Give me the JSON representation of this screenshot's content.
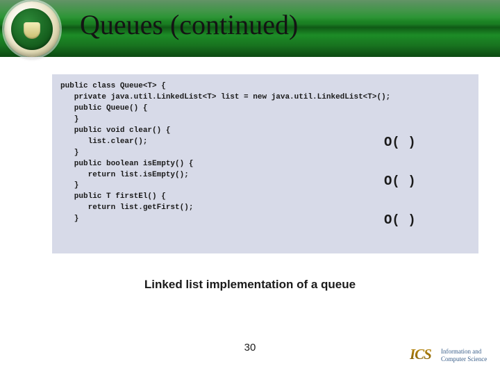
{
  "header": {
    "title": "Queues (continued)"
  },
  "code": {
    "text": "public class Queue<T> {\n   private java.util.LinkedList<T> list = new java.util.LinkedList<T>();\n   public Queue() {\n   }\n   public void clear() {\n      list.clear();\n   }\n   public boolean isEmpty() {\n      return list.isEmpty();\n   }\n   public T firstEl() {\n      return list.getFirst();\n   }"
  },
  "bigO": {
    "clear": "O(  )",
    "isEmpty": "O(  )",
    "firstEl": "O(  )"
  },
  "caption": "Linked list implementation of a queue",
  "page_number": "30",
  "footer": {
    "logo_short": "ICS",
    "line1": "Information and",
    "line2": "Computer Science"
  }
}
